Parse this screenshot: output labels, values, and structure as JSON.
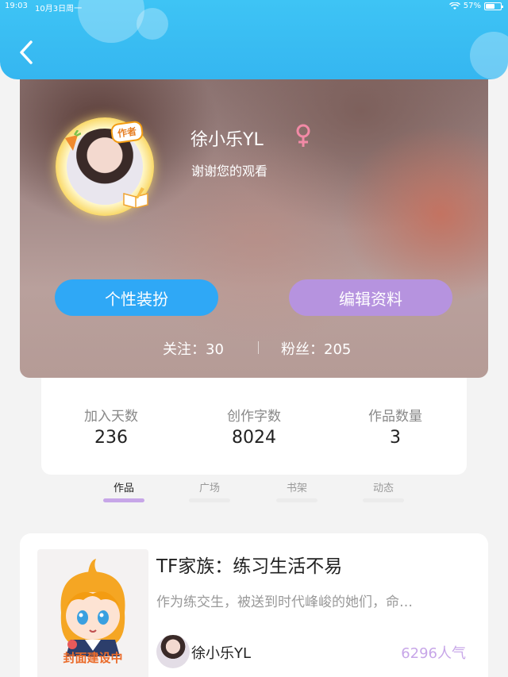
{
  "status_bar": {
    "time": "19:03",
    "date": "10月3日周一",
    "battery": "57%"
  },
  "profile": {
    "author_badge": "作者",
    "username": "徐小乐YL",
    "gender_icon": "female-icon",
    "bio": "谢谢您的观看",
    "buttons": {
      "dress_up": "个性装扮",
      "edit_profile": "编辑资料"
    },
    "following_label": "关注：",
    "following_count": "30",
    "fans_label": "粉丝：",
    "fans_count": "205"
  },
  "stats": [
    {
      "label": "加入天数",
      "value": "236"
    },
    {
      "label": "创作字数",
      "value": "8024"
    },
    {
      "label": "作品数量",
      "value": "3"
    }
  ],
  "tabs": [
    {
      "label": "作品",
      "active": true
    },
    {
      "label": "广场",
      "active": false
    },
    {
      "label": "书架",
      "active": false
    },
    {
      "label": "动态",
      "active": false
    }
  ],
  "works": [
    {
      "cover_label": "封面建设中",
      "title": "TF家族：练习生活不易",
      "description": "作为练交生，被送到时代峰峻的她们，命…",
      "author": "徐小乐YL",
      "popularity": "6296人气"
    }
  ],
  "colors": {
    "header_blue": "#35b6f0",
    "button_blue": "#2fa8f6",
    "button_purple": "#b693df",
    "tab_active_underline": "#c7a6e8",
    "popularity_purple": "#c7a6e8"
  }
}
